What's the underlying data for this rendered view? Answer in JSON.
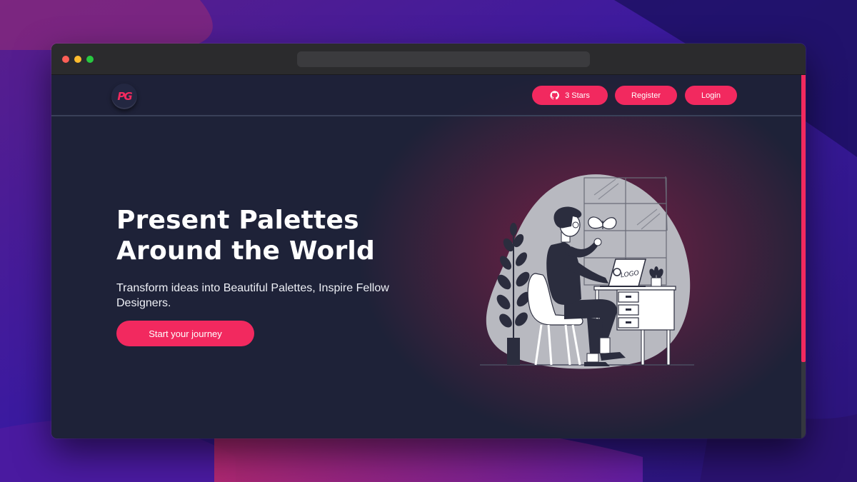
{
  "colors": {
    "accent": "#f2295f",
    "page_bg": "#1e2238",
    "titlebar": "#2b2b2d",
    "blob": "#b8b9c0"
  },
  "navbar": {
    "logo_text": "PG",
    "github_icon": "github-icon",
    "stars_label": "3 Stars",
    "register_label": "Register",
    "login_label": "Login"
  },
  "hero": {
    "title_line1": "Present Palettes",
    "title_line2": "Around the World",
    "subtitle": "Transform ideas into Beautiful Palettes, Inspire Fellow Designers.",
    "cta_label": "Start your journey"
  },
  "illustration": {
    "laptop_logo_text": "LOGO"
  }
}
